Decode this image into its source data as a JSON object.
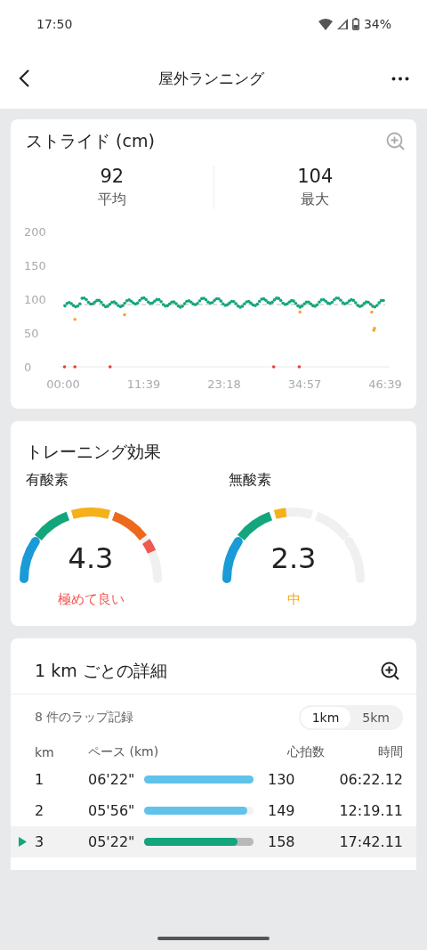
{
  "status_bar": {
    "time": "17:50",
    "battery": "34%"
  },
  "app_bar": {
    "title": "屋外ランニング"
  },
  "stride": {
    "title": "ストライド (cm)",
    "stats": [
      {
        "value": "92",
        "label": "平均"
      },
      {
        "value": "104",
        "label": "最大"
      }
    ],
    "y_labels": [
      "200",
      "150",
      "100",
      "50",
      "0"
    ],
    "x_labels": [
      "00:00",
      "11:39",
      "23:18",
      "34:57",
      "46:39"
    ]
  },
  "training": {
    "title": "トレーニング効果",
    "gauges": [
      {
        "label": "有酸素",
        "value": "4.3",
        "rating": "極めて良い",
        "color": "#ef5a50"
      },
      {
        "label": "無酸素",
        "value": "2.3",
        "rating": "中",
        "color": "#f5a623"
      }
    ]
  },
  "laps": {
    "title": "1 km ごとの詳細",
    "count": "8 件のラップ記録",
    "units": [
      {
        "label": "1km",
        "selected": true
      },
      {
        "label": "5km",
        "selected": false
      }
    ],
    "columns": [
      "km",
      "ペース (km)",
      "心拍数",
      "時間"
    ],
    "rows": [
      {
        "km": "1",
        "pace": "06'22\"",
        "level": 1.0,
        "heart_rate": "130",
        "time": "06:22.12",
        "selected": false
      },
      {
        "km": "2",
        "pace": "05'56\"",
        "level": 0.94,
        "heart_rate": "149",
        "time": "12:19.11",
        "selected": false
      },
      {
        "km": "3",
        "pace": "05'22\"",
        "level": 0.85,
        "heart_rate": "158",
        "time": "17:42.11",
        "selected": true
      }
    ]
  }
}
